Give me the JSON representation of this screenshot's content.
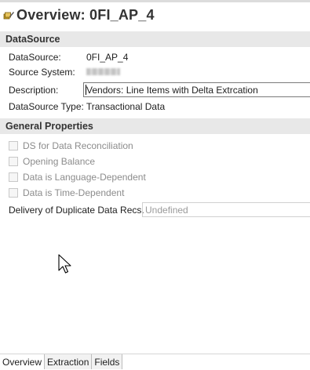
{
  "header": {
    "title": "Overview: 0FI_AP_4",
    "icon": "datasource-edit-icon"
  },
  "datasource_section": {
    "title": "DataSource",
    "datasource_label": "DataSource:",
    "datasource_value": "0FI_AP_4",
    "source_system_label": "Source System:",
    "description_label": "Description:",
    "description_value": "Vendors: Line Items with Delta Extrcation",
    "type_label": "DataSource Type:",
    "type_value": "Transactional Data"
  },
  "general_section": {
    "title": "General Properties",
    "checkboxes": [
      {
        "label": "DS for Data Reconciliation",
        "checked": false
      },
      {
        "label": "Opening Balance",
        "checked": false
      },
      {
        "label": "Data is Language-Dependent",
        "checked": false
      },
      {
        "label": "Data is Time-Dependent",
        "checked": false
      }
    ],
    "duplicate_label": "Delivery of Duplicate Data Recs.",
    "duplicate_value": "Undefined"
  },
  "tabs": [
    {
      "label": "Overview",
      "active": true
    },
    {
      "label": "Extraction",
      "active": false
    },
    {
      "label": "Fields",
      "active": false
    }
  ]
}
